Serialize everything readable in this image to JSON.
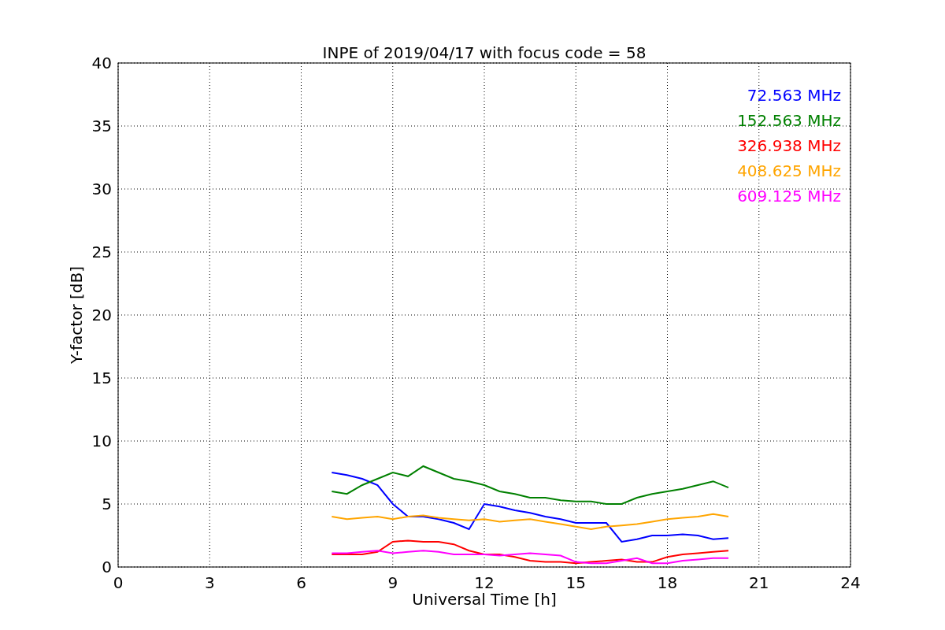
{
  "figure": {
    "chart_data": {
      "type": "line",
      "title": "INPE of 2019/04/17 with focus code = 58",
      "xlabel": "Universal Time [h]",
      "ylabel": "Y-factor [dB]",
      "grid": true,
      "xlim": [
        0,
        24
      ],
      "ylim": [
        0,
        40
      ],
      "xticks": [
        0,
        3,
        6,
        9,
        12,
        15,
        18,
        21,
        24
      ],
      "yticks": [
        0,
        5,
        10,
        15,
        20,
        25,
        30,
        35,
        40
      ],
      "x": [
        7,
        7.5,
        8,
        8.5,
        9,
        9.5,
        10,
        10.5,
        11,
        11.5,
        12,
        12.5,
        13,
        13.5,
        14,
        14.5,
        15,
        15.5,
        16,
        16.5,
        17,
        17.5,
        18,
        18.5,
        19,
        19.5,
        20
      ],
      "series": [
        {
          "name": "72.563 MHz",
          "color": "#0000ff",
          "values": [
            7.5,
            7.3,
            7,
            6.5,
            5,
            4,
            4,
            3.8,
            3.5,
            3,
            5,
            4.8,
            4.5,
            4.3,
            4,
            3.8,
            3.5,
            3.5,
            3.5,
            2,
            2.2,
            2.5,
            2.5,
            2.6,
            2.5,
            2.2,
            2.3
          ]
        },
        {
          "name": "152.563 MHz",
          "color": "#008000",
          "values": [
            6,
            5.8,
            6.5,
            7,
            7.5,
            7.2,
            8,
            7.5,
            7,
            6.8,
            6.5,
            6,
            5.8,
            5.5,
            5.5,
            5.3,
            5.2,
            5.2,
            5,
            5,
            5.5,
            5.8,
            6,
            6.2,
            6.5,
            6.8,
            6.3
          ]
        },
        {
          "name": "326.938 MHz",
          "color": "#ff0000",
          "values": [
            1,
            1,
            1,
            1.2,
            2,
            2.1,
            2,
            2,
            1.8,
            1.3,
            1,
            1,
            0.8,
            0.5,
            0.4,
            0.4,
            0.3,
            0.4,
            0.5,
            0.6,
            0.4,
            0.4,
            0.8,
            1,
            1.1,
            1.2,
            1.3
          ]
        },
        {
          "name": "408.625 MHz",
          "color": "#ffa500",
          "values": [
            4,
            3.8,
            3.9,
            4,
            3.8,
            4,
            4.1,
            3.9,
            3.8,
            3.7,
            3.8,
            3.6,
            3.7,
            3.8,
            3.6,
            3.4,
            3.2,
            3,
            3.2,
            3.3,
            3.4,
            3.6,
            3.8,
            3.9,
            4,
            4.2,
            4
          ]
        },
        {
          "name": "609.125 MHz",
          "color": "#ff00ff",
          "values": [
            1.1,
            1.1,
            1.2,
            1.3,
            1.1,
            1.2,
            1.3,
            1.2,
            1,
            1,
            1,
            0.9,
            1,
            1.1,
            1,
            0.9,
            0.4,
            0.3,
            0.3,
            0.5,
            0.7,
            0.3,
            0.3,
            0.5,
            0.6,
            0.7,
            0.7
          ]
        }
      ]
    }
  }
}
